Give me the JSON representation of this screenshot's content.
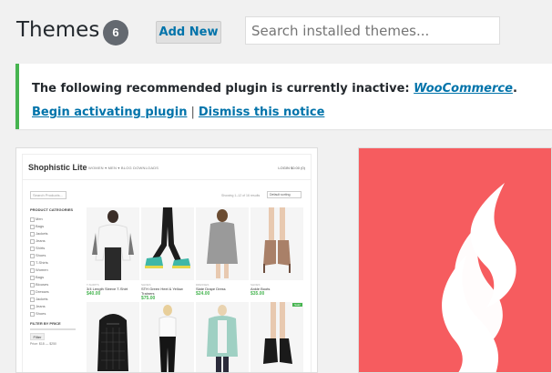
{
  "header": {
    "title": "Themes",
    "count": "6",
    "add_new_label": "Add New",
    "search_placeholder": "Search installed themes..."
  },
  "notice": {
    "message_prefix": "The following recommended plugin is currently inactive: ",
    "plugin_name": "WooCommerce",
    "message_suffix": ".",
    "activate_label": "Begin activating plugin",
    "separator": "|",
    "dismiss_label": "Dismiss this notice",
    "border_color": "#46b450"
  },
  "theme1": {
    "site_title": "Shophistic Lite",
    "nav_text": "WOMEN ▾    MEN ▾    BLOG    DOWNLOADS",
    "login_text": "LOGIN   $0.00 (0)",
    "search_placeholder": "Search Products...",
    "showing_text": "Showing 1–12 of 16 results",
    "sort_label": "Default sorting",
    "categories_heading": "PRODUCT CATEGORIES",
    "categories": [
      "Men",
      "Bags",
      "Jackets",
      "Jeans",
      "Shirts",
      "Shoes",
      "T-Shirts",
      "Women",
      "Bags",
      "Blouses",
      "Dresses",
      "Jackets",
      "Jeans",
      "Shoes"
    ],
    "price_heading": "FILTER BY PRICE",
    "filter_label": "Filter",
    "price_range": "Price: $18 — $250",
    "products": [
      {
        "cat": "T-SHIRTS",
        "name": "3/4 Length Sleeve T-Shirt",
        "price": "$40.00"
      },
      {
        "cat": "SHOES",
        "name": "STH Green Heel & Yellow Trainers",
        "price": "$75.00"
      },
      {
        "cat": "DRESSES",
        "name": "Slate Drape Dress",
        "price": "$24.00"
      },
      {
        "cat": "SHOES",
        "name": "Ankle Boots",
        "price": "$35.00"
      }
    ],
    "sale_badge": "Sale!"
  },
  "theme2": {
    "accent_color": "#f65c5f",
    "icon": "flame-logo-icon"
  }
}
